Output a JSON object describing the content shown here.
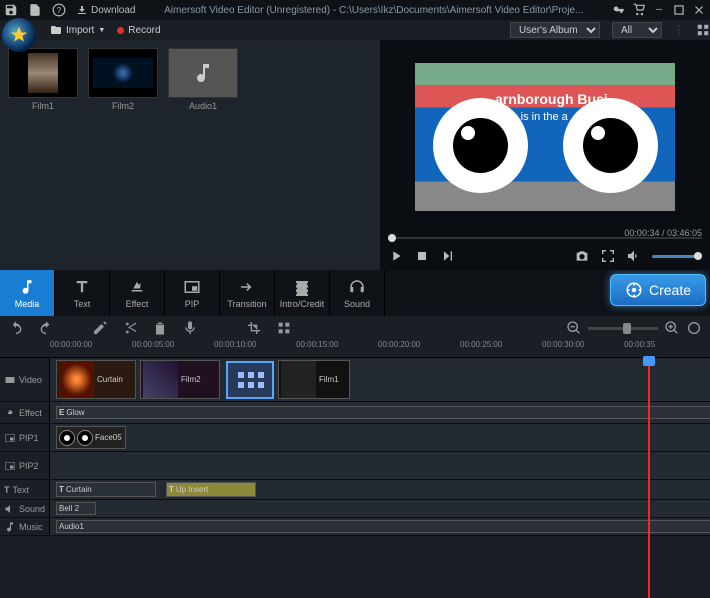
{
  "titlebar": {
    "download": "Download",
    "title": "Aimersoft Video Editor (Unregistered) - C:\\Users\\Ikz\\Documents\\Aimersoft Video Editor\\Proje..."
  },
  "toprow": {
    "import": "Import",
    "record": "Record",
    "album": "User's Album",
    "filter": "All"
  },
  "library": {
    "items": [
      {
        "label": "Film1"
      },
      {
        "label": "Film2"
      },
      {
        "label": "Audio1"
      }
    ]
  },
  "preview": {
    "time": "00:00:34 / 03:46:05",
    "overlay1": "arnborough Busi",
    "overlay2": "cess is in the a"
  },
  "tabs": {
    "media": "Media",
    "text": "Text",
    "effect": "Effect",
    "pip": "PIP",
    "transition": "Transition",
    "intro": "Intro/Credit",
    "sound": "Sound"
  },
  "create": "Create",
  "ruler": [
    "00:00:00:00",
    "00:00:05:00",
    "00:00:10:00",
    "00:00:15:00",
    "00:00:20:00",
    "00:00:25:00",
    "00:00:30:00",
    "00:00:35"
  ],
  "tracks": {
    "video": "Video",
    "effect": "Effect",
    "pip1": "PIP1",
    "pip2": "PIP2",
    "text": "Text",
    "sound": "Sound",
    "music": "Music"
  },
  "clips": {
    "curtain": "Curtain",
    "film2": "Film2",
    "film1": "Film1",
    "glow": "Glow",
    "face05": "Face05",
    "textCurtain": "Curtain",
    "upInsert": "Up Insert",
    "bell2": "Bell 2",
    "audio1": "Audio1"
  }
}
